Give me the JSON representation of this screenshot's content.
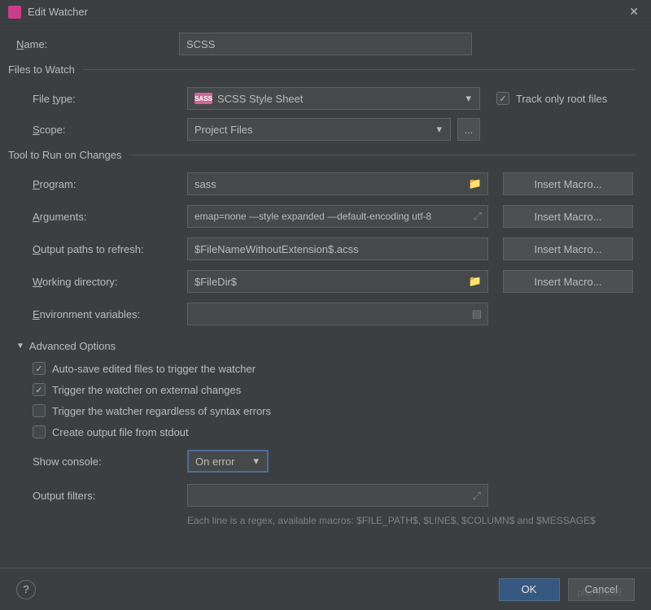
{
  "window": {
    "title": "Edit Watcher"
  },
  "name": {
    "label": "Name:",
    "value": "SCSS"
  },
  "filesToWatch": {
    "header": "Files to Watch",
    "fileType": {
      "label": "File type:",
      "value": "SCSS Style Sheet"
    },
    "trackRoot": {
      "label": "Track only root files",
      "checked": true
    },
    "scope": {
      "label": "Scope:",
      "value": "Project Files"
    }
  },
  "toolSection": {
    "header": "Tool to Run on Changes",
    "program": {
      "label": "Program:",
      "value": "sass",
      "macro": "Insert Macro..."
    },
    "arguments": {
      "label": "Arguments:",
      "value": "emap=none —style expanded —default-encoding utf-8",
      "macro": "Insert Macro..."
    },
    "outputPaths": {
      "label": "Output paths to refresh:",
      "value": "$FileNameWithoutExtension$.acss",
      "macro": "Insert Macro..."
    },
    "workingDir": {
      "label": "Working directory:",
      "value": "$FileDir$",
      "macro": "Insert Macro..."
    },
    "envVars": {
      "label": "Environment variables:",
      "value": ""
    }
  },
  "advanced": {
    "header": "Advanced Options",
    "opts": [
      {
        "label": "Auto-save edited files to trigger the watcher",
        "checked": true
      },
      {
        "label": "Trigger the watcher on external changes",
        "checked": true
      },
      {
        "label": "Trigger the watcher regardless of syntax errors",
        "checked": false
      },
      {
        "label": "Create output file from stdout",
        "checked": false
      }
    ],
    "showConsole": {
      "label": "Show console:",
      "value": "On error"
    },
    "outputFilters": {
      "label": "Output filters:"
    },
    "hint": "Each line is a regex, available macros: $FILE_PATH$, $LINE$, $COLUMN$ and $MESSAGE$"
  },
  "footer": {
    "ok": "OK",
    "cancel": "Cancel"
  },
  "watermark": "php 中文网"
}
